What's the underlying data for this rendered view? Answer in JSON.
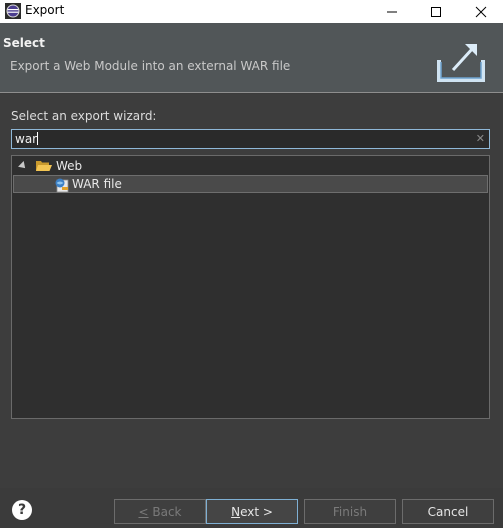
{
  "window": {
    "title": "Export",
    "app_icon": "eclipse-icon",
    "controls": [
      "minimize-icon",
      "maximize-icon",
      "close-icon"
    ]
  },
  "banner": {
    "title": "Select",
    "description": "Export a Web Module into an external WAR file",
    "icon": "export-wizard-icon"
  },
  "wizard": {
    "prompt": "Select an export wizard:",
    "filter_value": "war",
    "tree": [
      {
        "label": "Web",
        "icon": "folder-open-icon",
        "expanded": true
      },
      {
        "label": "WAR file",
        "icon": "war-file-icon",
        "selected": true
      }
    ]
  },
  "buttons": {
    "back": {
      "mnemonic": "<",
      "rest": " Back"
    },
    "next": {
      "mnemonic": "N",
      "rest": "ext >"
    },
    "finish": "Finish",
    "cancel": "Cancel"
  },
  "colors": {
    "accent_border": "#8fb8d8",
    "banner_bg": "#515658",
    "dialog_bg": "#3b3b3b"
  }
}
